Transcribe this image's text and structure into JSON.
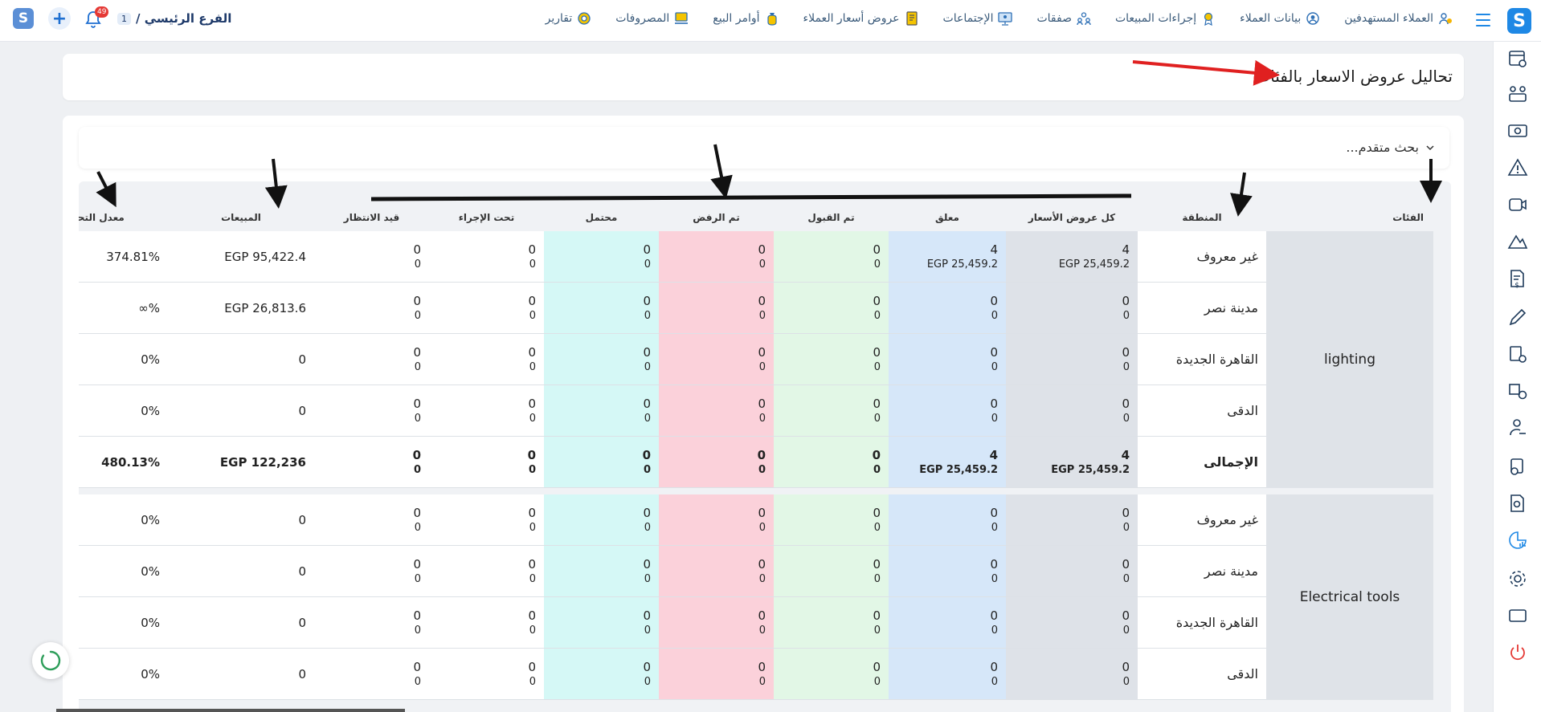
{
  "header": {
    "logo_letter": "S",
    "nav": [
      {
        "label": "العملاء المستهدفين",
        "icon": "users-target-icon"
      },
      {
        "label": "بيانات العملاء",
        "icon": "client-data-icon"
      },
      {
        "label": "إجراءات المبيعات",
        "icon": "sales-actions-icon"
      },
      {
        "label": "صفقات",
        "icon": "deals-icon"
      },
      {
        "label": "الإجتماعات",
        "icon": "meetings-icon"
      },
      {
        "label": "عروض أسعار العملاء",
        "icon": "quotations-icon"
      },
      {
        "label": "أوامر البيع",
        "icon": "sales-orders-icon"
      },
      {
        "label": "المصروفات",
        "icon": "expenses-icon"
      },
      {
        "label": "تقارير",
        "icon": "reports-icon"
      }
    ],
    "branch": {
      "label": "الفرع الرئيسي /",
      "number": "1"
    },
    "notification_count": "49",
    "plus": "+",
    "small_logo": "S"
  },
  "page": {
    "title": "تحاليل عروض الاسعار بالفئات",
    "advanced_search": "بحث متقدم..."
  },
  "table": {
    "headers": {
      "category": "الفئات",
      "region": "المنطقة",
      "all": "كل عروض الأسعار",
      "pending": "معلق",
      "accepted": "تم القبول",
      "rejected": "تم الرفض",
      "potential": "محتمل",
      "in_process": "تحت الإجراء",
      "waiting": "قيد الانتظار",
      "sales": "المبيعات",
      "conversion": "معدل التحويل"
    },
    "groups": [
      {
        "category": "lighting",
        "rows": [
          {
            "region": "غير معروف",
            "all": [
              "4",
              "EGP 25,459.2"
            ],
            "pending": [
              "4",
              "EGP 25,459.2"
            ],
            "accepted": [
              "0",
              "0"
            ],
            "rejected": [
              "0",
              "0"
            ],
            "potential": [
              "0",
              "0"
            ],
            "in_process": [
              "0",
              "0"
            ],
            "waiting": [
              "0",
              "0"
            ],
            "sales": "EGP 95,422.4",
            "conversion": "374.81%"
          },
          {
            "region": "مدينة نصر",
            "all": [
              "0",
              "0"
            ],
            "pending": [
              "0",
              "0"
            ],
            "accepted": [
              "0",
              "0"
            ],
            "rejected": [
              "0",
              "0"
            ],
            "potential": [
              "0",
              "0"
            ],
            "in_process": [
              "0",
              "0"
            ],
            "waiting": [
              "0",
              "0"
            ],
            "sales": "EGP 26,813.6",
            "conversion": "%∞"
          },
          {
            "region": "القاهرة الجديدة",
            "all": [
              "0",
              "0"
            ],
            "pending": [
              "0",
              "0"
            ],
            "accepted": [
              "0",
              "0"
            ],
            "rejected": [
              "0",
              "0"
            ],
            "potential": [
              "0",
              "0"
            ],
            "in_process": [
              "0",
              "0"
            ],
            "waiting": [
              "0",
              "0"
            ],
            "sales": "0",
            "conversion": "0%"
          },
          {
            "region": "الدقى",
            "all": [
              "0",
              "0"
            ],
            "pending": [
              "0",
              "0"
            ],
            "accepted": [
              "0",
              "0"
            ],
            "rejected": [
              "0",
              "0"
            ],
            "potential": [
              "0",
              "0"
            ],
            "in_process": [
              "0",
              "0"
            ],
            "waiting": [
              "0",
              "0"
            ],
            "sales": "0",
            "conversion": "0%"
          },
          {
            "region": "الإجمالى",
            "total": true,
            "all": [
              "4",
              "EGP 25,459.2"
            ],
            "pending": [
              "4",
              "EGP 25,459.2"
            ],
            "accepted": [
              "0",
              "0"
            ],
            "rejected": [
              "0",
              "0"
            ],
            "potential": [
              "0",
              "0"
            ],
            "in_process": [
              "0",
              "0"
            ],
            "waiting": [
              "0",
              "0"
            ],
            "sales": "EGP 122,236",
            "conversion": "480.13%"
          }
        ]
      },
      {
        "category": "Electrical tools",
        "rows": [
          {
            "region": "غير معروف",
            "all": [
              "0",
              "0"
            ],
            "pending": [
              "0",
              "0"
            ],
            "accepted": [
              "0",
              "0"
            ],
            "rejected": [
              "0",
              "0"
            ],
            "potential": [
              "0",
              "0"
            ],
            "in_process": [
              "0",
              "0"
            ],
            "waiting": [
              "0",
              "0"
            ],
            "sales": "0",
            "conversion": "0%"
          },
          {
            "region": "مدينة نصر",
            "all": [
              "0",
              "0"
            ],
            "pending": [
              "0",
              "0"
            ],
            "accepted": [
              "0",
              "0"
            ],
            "rejected": [
              "0",
              "0"
            ],
            "potential": [
              "0",
              "0"
            ],
            "in_process": [
              "0",
              "0"
            ],
            "waiting": [
              "0",
              "0"
            ],
            "sales": "0",
            "conversion": "0%"
          },
          {
            "region": "القاهرة الجديدة",
            "all": [
              "0",
              "0"
            ],
            "pending": [
              "0",
              "0"
            ],
            "accepted": [
              "0",
              "0"
            ],
            "rejected": [
              "0",
              "0"
            ],
            "potential": [
              "0",
              "0"
            ],
            "in_process": [
              "0",
              "0"
            ],
            "waiting": [
              "0",
              "0"
            ],
            "sales": "0",
            "conversion": "0%"
          },
          {
            "region": "الدقى",
            "all": [
              "0",
              "0"
            ],
            "pending": [
              "0",
              "0"
            ],
            "accepted": [
              "0",
              "0"
            ],
            "rejected": [
              "0",
              "0"
            ],
            "potential": [
              "0",
              "0"
            ],
            "in_process": [
              "0",
              "0"
            ],
            "waiting": [
              "0",
              "0"
            ],
            "sales": "0",
            "conversion": "0%"
          }
        ]
      }
    ]
  },
  "sidebar_icons": [
    "calendar-settings-icon",
    "team-icon",
    "money-icon",
    "warning-icon",
    "video-icon",
    "mountain-icon",
    "invoice-dollar-icon",
    "pen-icon",
    "report-add-icon",
    "shipping-settings-icon",
    "user-hand-icon",
    "cart-add-icon",
    "document-search-icon",
    "analytics-icon",
    "gear-icon",
    "window-icon",
    "power-icon"
  ],
  "colors": {
    "accent": "#1e88e5",
    "all_col": "#dee2e8",
    "pending_col": "#d6e7f9",
    "accepted_col": "#e2f7e6",
    "rejected_col": "#fbd1da",
    "potential_col": "#d5f8f6",
    "annotation_red": "#e02020"
  }
}
